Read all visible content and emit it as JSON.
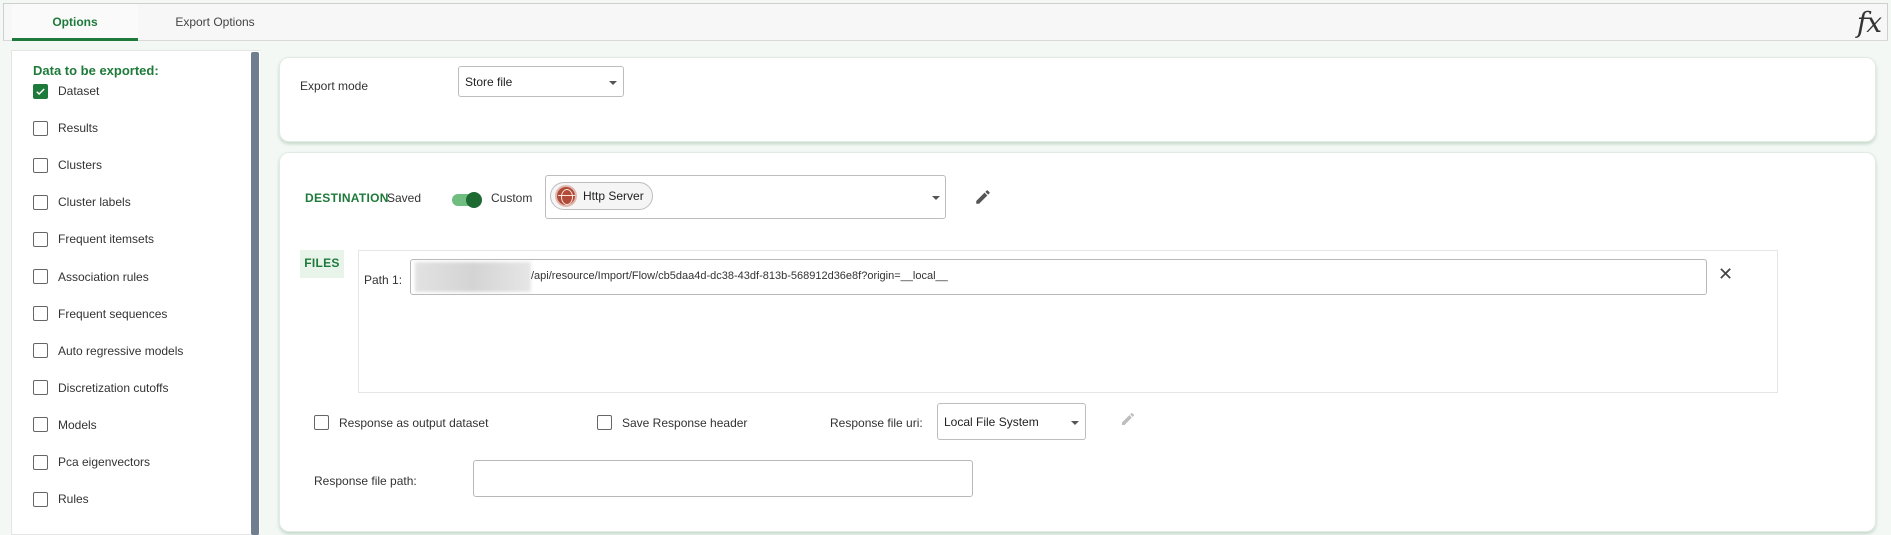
{
  "tabs": [
    {
      "label": "Options",
      "active": true
    },
    {
      "label": "Export Options",
      "active": false
    }
  ],
  "formula_icon": "fx",
  "left_panel": {
    "title": "Data to be exported:",
    "items": [
      {
        "label": "Dataset",
        "checked": true
      },
      {
        "label": "Results",
        "checked": false
      },
      {
        "label": "Clusters",
        "checked": false
      },
      {
        "label": "Cluster labels",
        "checked": false
      },
      {
        "label": "Frequent itemsets",
        "checked": false
      },
      {
        "label": "Association rules",
        "checked": false
      },
      {
        "label": "Frequent sequences",
        "checked": false
      },
      {
        "label": "Auto regressive models",
        "checked": false
      },
      {
        "label": "Discretization cutoffs",
        "checked": false
      },
      {
        "label": "Models",
        "checked": false
      },
      {
        "label": "Pca eigenvectors",
        "checked": false
      },
      {
        "label": "Rules",
        "checked": false
      }
    ]
  },
  "export_mode": {
    "label": "Export mode",
    "value": "Store file"
  },
  "destination": {
    "title": "DESTINATION",
    "saved_label": "Saved",
    "custom_label": "Custom",
    "toggle_on": true,
    "server_chip": "Http Server",
    "server_icon": "globe-icon"
  },
  "files": {
    "tag": "FILES",
    "path_label": "Path 1:",
    "path_value": "/api/resource/Import/Flow/cb5daa4d-dc38-43df-813b-568912d36e8f?origin=__local__"
  },
  "response": {
    "as_output_label": "Response as output dataset",
    "save_header_label": "Save Response header",
    "file_uri_label": "Response file uri:",
    "file_uri_value": "Local File System",
    "file_path_label": "Response file path:",
    "file_path_value": ""
  },
  "colors": {
    "accent": "#1e7a3a",
    "scrollbar": "#6f7f90"
  }
}
